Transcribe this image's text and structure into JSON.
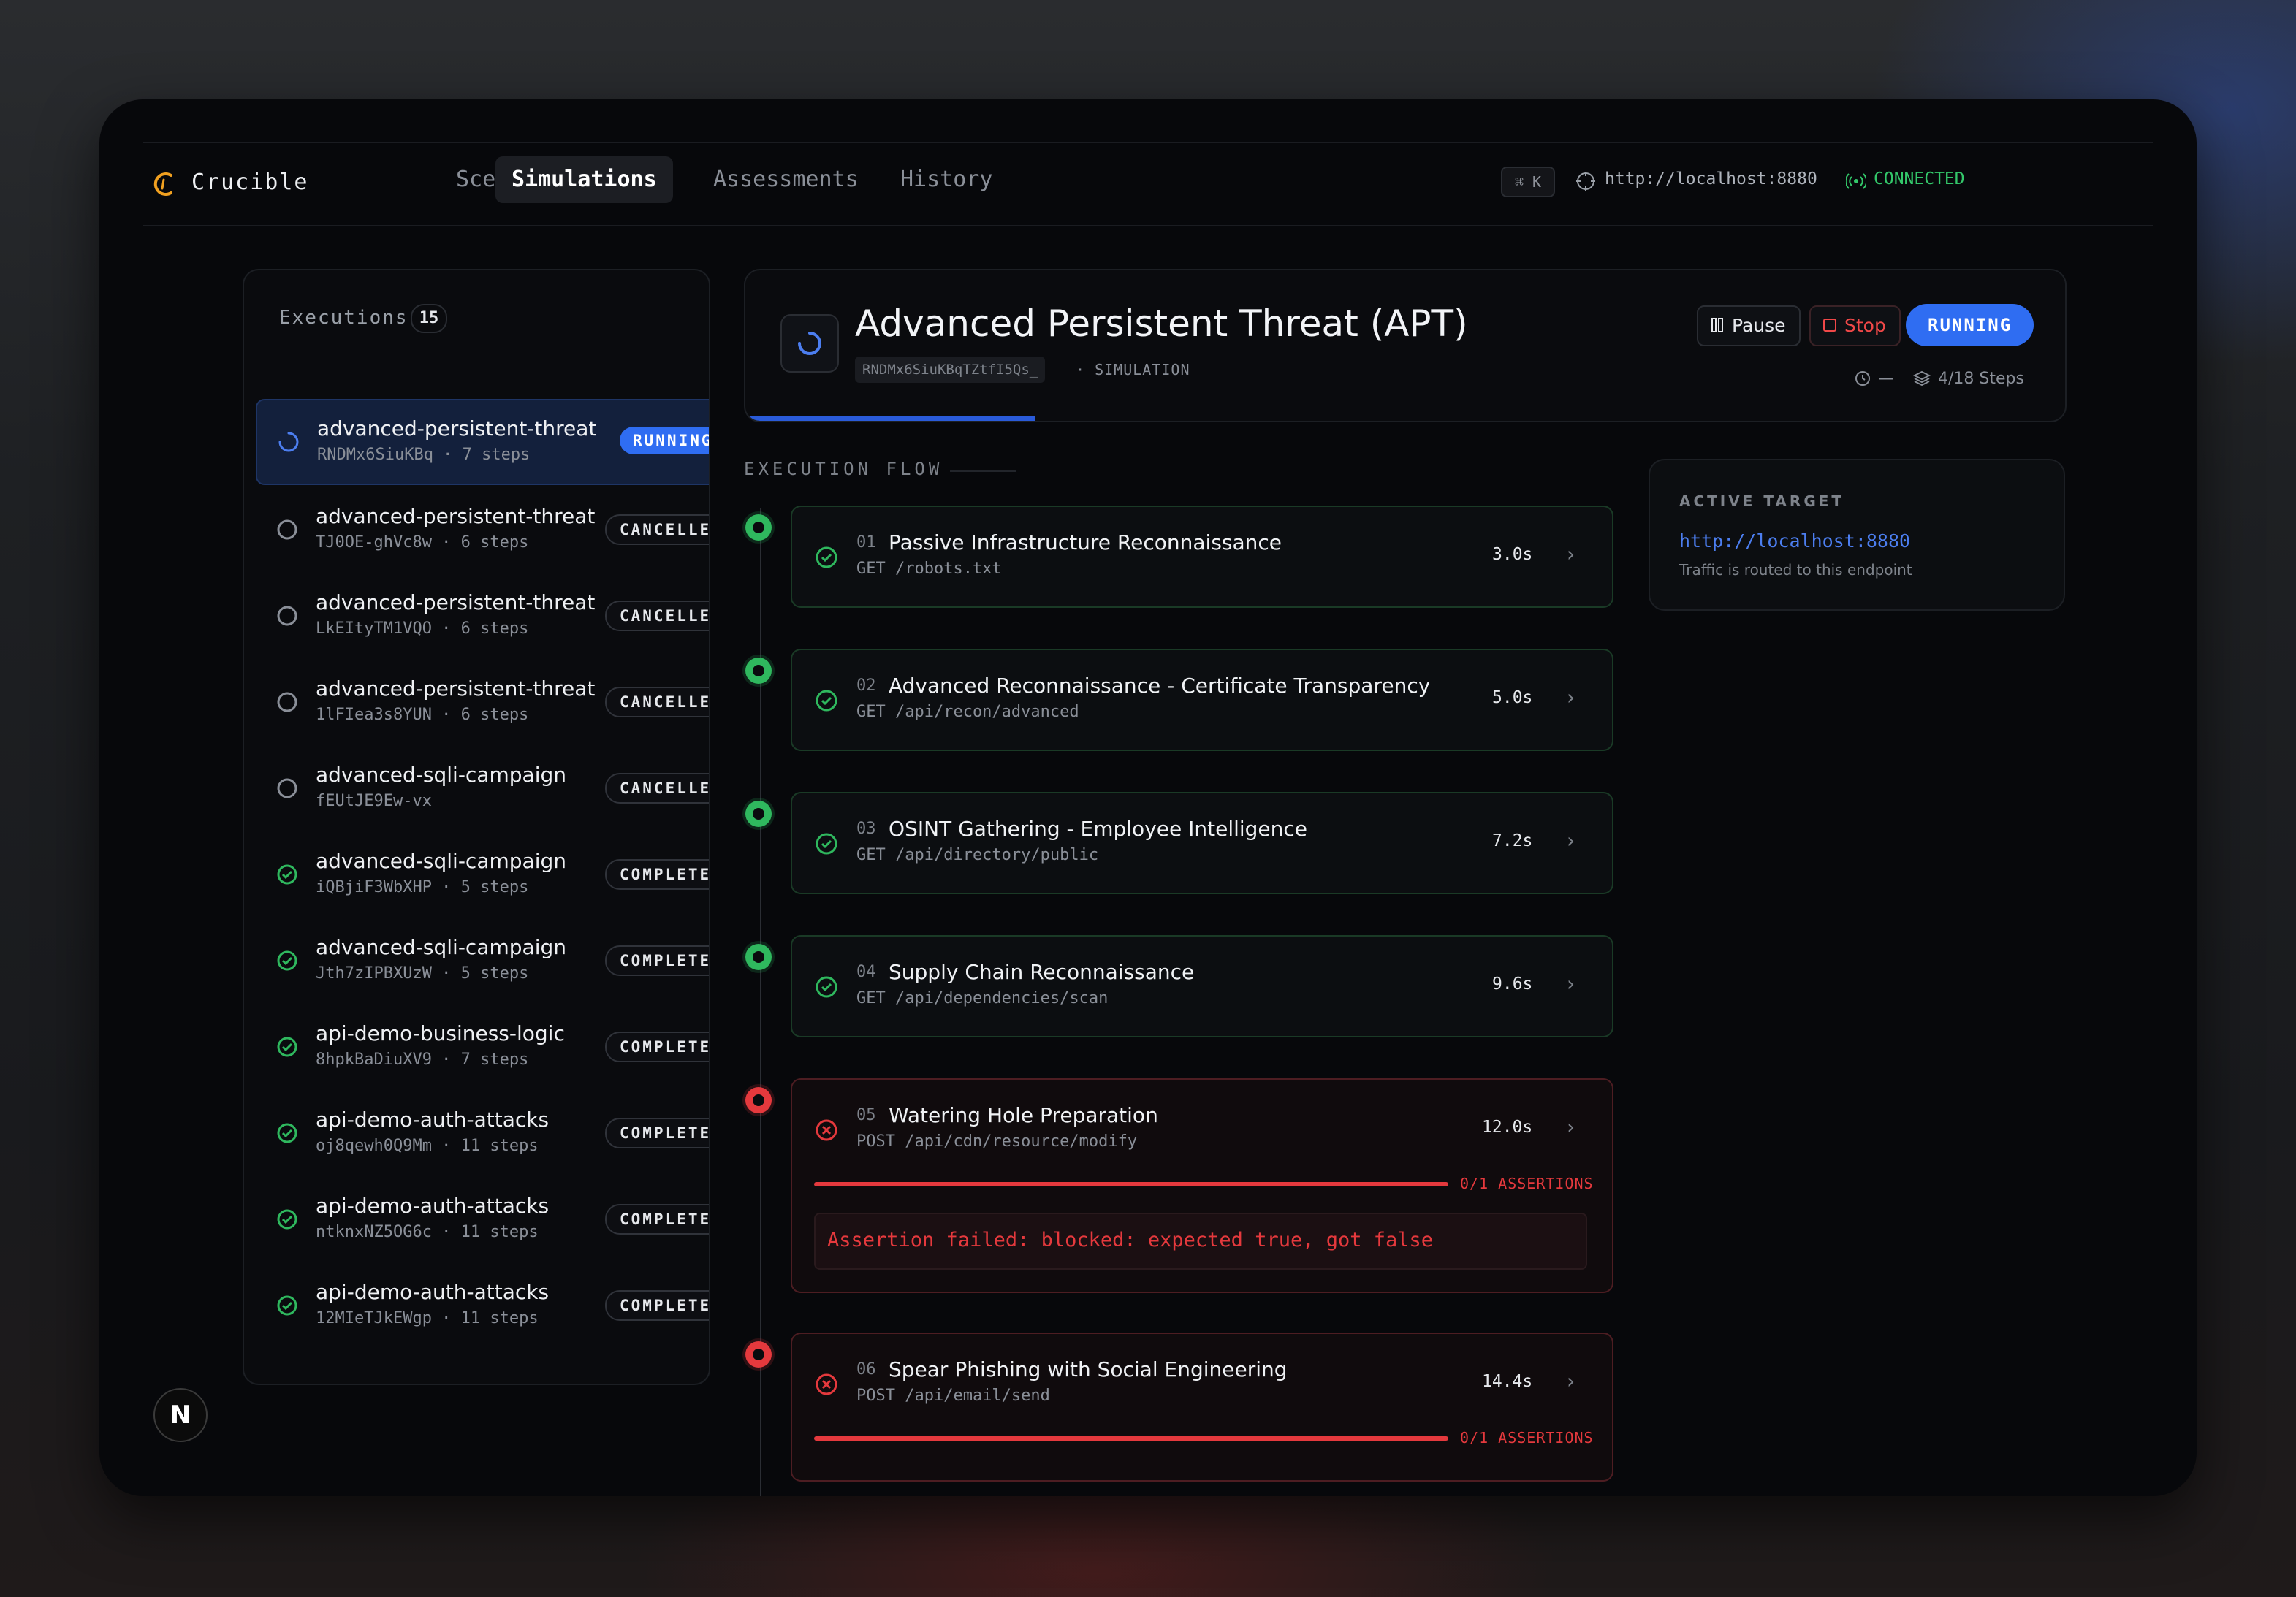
{
  "app": {
    "name": "Crucible"
  },
  "nav": {
    "tabs": [
      {
        "label": "Scenarios"
      },
      {
        "label": "Simulations"
      },
      {
        "label": "Assessments"
      },
      {
        "label": "History"
      }
    ],
    "shortcut": "⌘ K",
    "target_url": "http://localhost:8880",
    "connection_status": "CONNECTED"
  },
  "executions": {
    "title": "Executions",
    "count": "15",
    "items": [
      {
        "name": "advanced-persistent-threat",
        "sub": "RNDMx6SiuKBq · 7 steps",
        "status": "RUNNING",
        "state": "running"
      },
      {
        "name": "advanced-persistent-threat",
        "sub": "TJ0OE-ghVc8w · 6 steps",
        "status": "CANCELLED",
        "state": "cancelled"
      },
      {
        "name": "advanced-persistent-threat",
        "sub": "LkEItyTM1VQO · 6 steps",
        "status": "CANCELLED",
        "state": "cancelled"
      },
      {
        "name": "advanced-persistent-threat",
        "sub": "1lFIea3s8YUN · 6 steps",
        "status": "CANCELLED",
        "state": "cancelled"
      },
      {
        "name": "advanced-sqli-campaign",
        "sub": "fEUtJE9Ew-vx",
        "status": "CANCELLED",
        "state": "cancelled"
      },
      {
        "name": "advanced-sqli-campaign",
        "sub": "iQBjiF3WbXHP · 5 steps",
        "status": "COMPLETED",
        "state": "completed"
      },
      {
        "name": "advanced-sqli-campaign",
        "sub": "Jth7zIPBXUzW · 5 steps",
        "status": "COMPLETED",
        "state": "completed"
      },
      {
        "name": "api-demo-business-logic",
        "sub": "8hpkBaDiuXV9 · 7 steps",
        "status": "COMPLETED",
        "state": "completed"
      },
      {
        "name": "api-demo-auth-attacks",
        "sub": "oj8qewh0Q9Mm · 11 steps",
        "status": "COMPLETED",
        "state": "completed"
      },
      {
        "name": "api-demo-auth-attacks",
        "sub": "ntknxNZ5OG6c · 11 steps",
        "status": "COMPLETED",
        "state": "completed"
      },
      {
        "name": "api-demo-auth-attacks",
        "sub": "12MIeTJkEWgp · 11 steps",
        "status": "COMPLETED",
        "state": "completed"
      }
    ]
  },
  "detail": {
    "title": "Advanced Persistent Threat (APT)",
    "id": "RNDMx6SiuKBqTZtfI5Qs_",
    "type": "· SIMULATION",
    "pause_label": "Pause",
    "stop_label": "Stop",
    "status": "RUNNING",
    "elapsed": "—",
    "steps_progress": "4/18 Steps",
    "progress_fraction": 0.22
  },
  "flow": {
    "label": "EXECUTION FLOW",
    "steps": [
      {
        "num": "01",
        "title": "Passive Infrastructure Reconnaissance",
        "endpoint": "GET /robots.txt",
        "duration": "3.0s",
        "state": "ok"
      },
      {
        "num": "02",
        "title": "Advanced Reconnaissance - Certificate Transparency",
        "endpoint": "GET /api/recon/advanced",
        "duration": "5.0s",
        "state": "ok"
      },
      {
        "num": "03",
        "title": "OSINT Gathering - Employee Intelligence",
        "endpoint": "GET /api/directory/public",
        "duration": "7.2s",
        "state": "ok"
      },
      {
        "num": "04",
        "title": "Supply Chain Reconnaissance",
        "endpoint": "GET /api/dependencies/scan",
        "duration": "9.6s",
        "state": "ok"
      },
      {
        "num": "05",
        "title": "Watering Hole Preparation",
        "endpoint": "POST /api/cdn/resource/modify",
        "duration": "12.0s",
        "state": "err",
        "assertions": "0/1 ASSERTIONS",
        "error": "Assertion failed: blocked: expected true, got false"
      },
      {
        "num": "06",
        "title": "Spear Phishing with Social Engineering",
        "endpoint": "POST /api/email/send",
        "duration": "14.4s",
        "state": "err",
        "assertions": "0/1 ASSERTIONS"
      }
    ]
  },
  "active_target": {
    "label": "ACTIVE TARGET",
    "url": "http://localhost:8880",
    "note": "Traffic is routed to this endpoint"
  },
  "colors": {
    "accent": "#2f6df2",
    "success": "#2fb85e",
    "error": "#e5393d",
    "brand": "#f0a020"
  }
}
